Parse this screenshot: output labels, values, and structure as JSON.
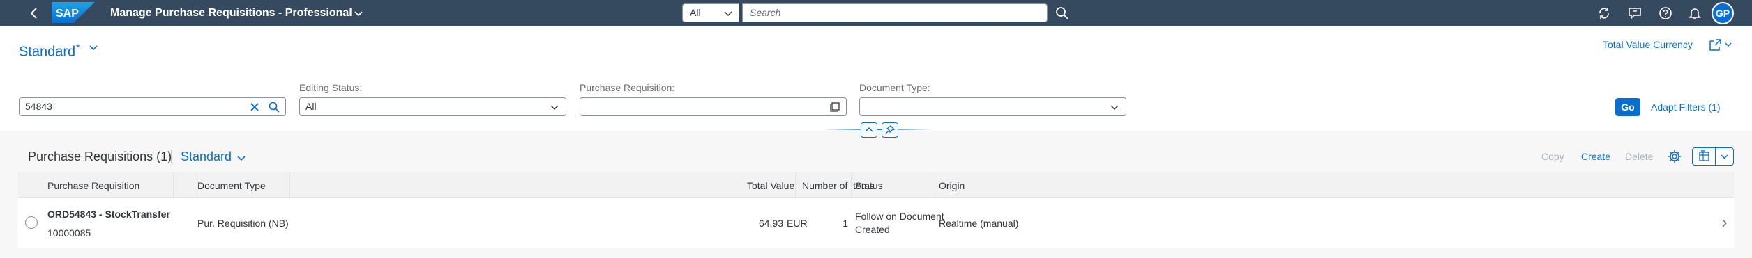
{
  "shell": {
    "logo_text": "SAP",
    "app_title": "Manage Purchase Requisitions - Professional",
    "search_scope": "All",
    "search_placeholder": "Search",
    "user_initials": "GP",
    "icons": [
      "back-icon",
      "chevron-down-icon",
      "search-icon",
      "sync-icon",
      "feedback-icon",
      "help-icon",
      "notifications-icon"
    ]
  },
  "header": {
    "variant_name": "Standard",
    "variant_modified_marker": "*",
    "total_value_currency": "Total Value Currency",
    "filters": {
      "search_value": "54843",
      "editing_status_label": "Editing Status:",
      "editing_status_value": "All",
      "purchase_requisition_label": "Purchase Requisition:",
      "purchase_requisition_value": "",
      "document_type_label": "Document Type:",
      "document_type_value": ""
    },
    "go_label": "Go",
    "adapt_filters_label": "Adapt Filters (1)"
  },
  "table": {
    "title": "Purchase Requisitions (1)",
    "variant": "Standard",
    "actions": {
      "copy": "Copy",
      "create": "Create",
      "delete": "Delete"
    },
    "columns": {
      "purchase_requisition": "Purchase Requisition",
      "document_type": "Document Type",
      "total_value": "Total Value",
      "number_of_items": "Number of Items",
      "status": "Status",
      "origin": "Origin"
    },
    "rows": [
      {
        "title": "ORD54843 - StockTransfer",
        "id": "10000085",
        "document_type": "Pur. Requisition (NB)",
        "total_value": "64.93",
        "currency": "EUR",
        "number_of_items": "1",
        "status_line1": "Follow on Document",
        "status_line2": "Created",
        "origin": "Realtime (manual)"
      }
    ]
  },
  "colors": {
    "shell_bg": "#354a5f",
    "accent": "#0a6ed1",
    "text": "#32363a",
    "disabled_text": "#a9b4be"
  }
}
